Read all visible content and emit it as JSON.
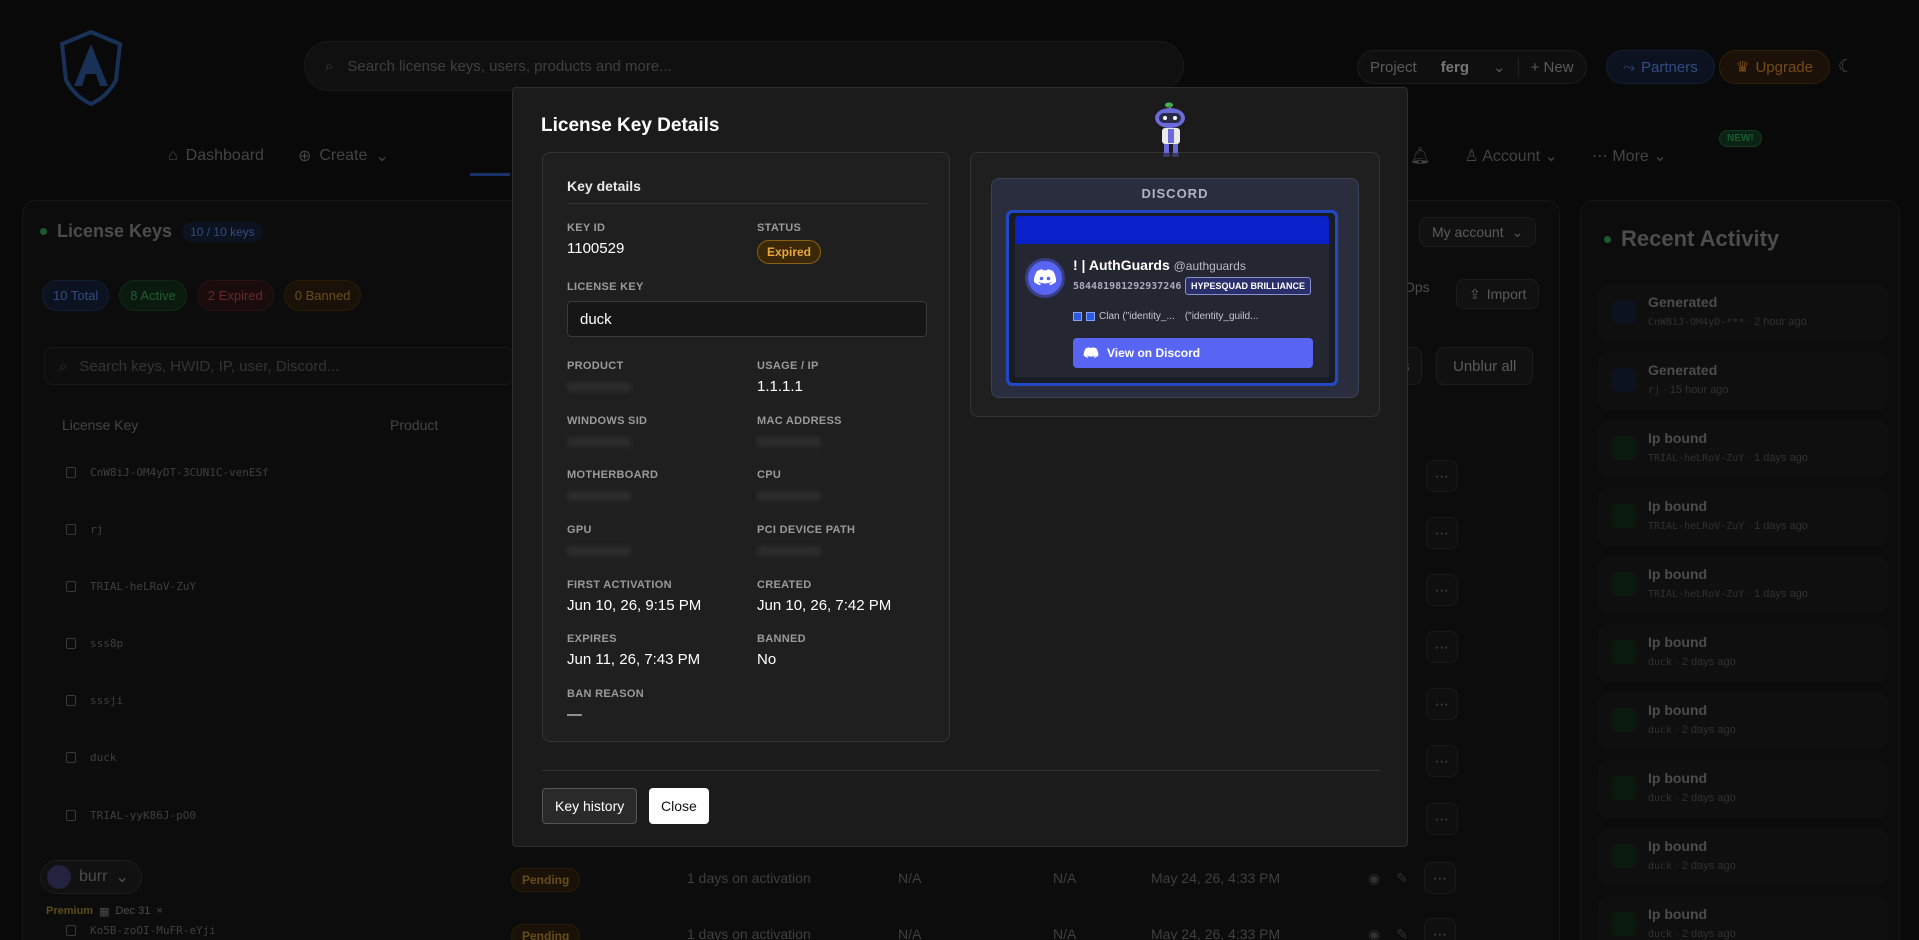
{
  "topbar": {
    "search_placeholder": "Search license keys, users, products and more...",
    "project_label": "Project",
    "project_name": "ferg",
    "new_label": "+ New",
    "partners_label": "Partners",
    "upgrade_label": "Upgrade"
  },
  "nav": {
    "items": [
      "Dashboard",
      "Create"
    ],
    "right_items": [
      "Account",
      "More"
    ],
    "new_badge": "NEW!"
  },
  "license_panel": {
    "title": "License Keys",
    "keys_pill": "10 / 10 keys",
    "pills": {
      "total": "10 Total",
      "active": "8 Active",
      "expired": "2 Expired",
      "banned": "0 Banned"
    },
    "search_placeholder": "Search keys, HWID, IP, user, Discord...",
    "unblur_label": "Unblur all",
    "my_account_label": "My account",
    "ops_label": "Ops",
    "import_label": "Import",
    "col_license_key": "License Key",
    "col_product": "Product",
    "rows": [
      "CnW8iJ-OM4yDT-3CUN1C-venESf",
      "rj",
      "TRIAL-heLRoV-ZuY",
      "sss8p",
      "sssji",
      "duck",
      "TRIAL-yyK86J-pO0",
      "",
      "Ko5B-zoOI-MuFR-eYji"
    ],
    "pending_label": "Pending",
    "activation_text": "1 days on activation",
    "na": "N/A",
    "created_text": "May 24, 26, 4:33 PM"
  },
  "user": {
    "name": "burr",
    "plan": "Premium",
    "date": "Dec 31"
  },
  "recent_activity": {
    "title": "Recent Activity",
    "items": [
      {
        "name": "Generated",
        "key": "CnW8iJ-OM4yD-***",
        "time": "2 hour ago",
        "kind": "generated"
      },
      {
        "name": "Generated",
        "key": "rj",
        "time": "15 hour ago",
        "kind": "generated"
      },
      {
        "name": "Ip bound",
        "key": "TRIAL-heLRoV-ZuY",
        "time": "1 days ago",
        "kind": "ip"
      },
      {
        "name": "Ip bound",
        "key": "TRIAL-heLRoV-ZuY",
        "time": "1 days ago",
        "kind": "ip"
      },
      {
        "name": "Ip bound",
        "key": "TRIAL-heLRoV-ZuY",
        "time": "1 days ago",
        "kind": "ip"
      },
      {
        "name": "Ip bound",
        "key": "duck",
        "time": "2 days ago",
        "kind": "ip"
      },
      {
        "name": "Ip bound",
        "key": "duck",
        "time": "2 days ago",
        "kind": "ip"
      },
      {
        "name": "Ip bound",
        "key": "duck",
        "time": "2 days ago",
        "kind": "ip"
      },
      {
        "name": "Ip bound",
        "key": "duck",
        "time": "2 days ago",
        "kind": "ip"
      },
      {
        "name": "Ip bound",
        "key": "duck",
        "time": "2 days ago",
        "kind": "ip"
      }
    ]
  },
  "modal": {
    "title": "License Key Details",
    "section_title": "Key details",
    "key_id_label": "KEY ID",
    "key_id": "1100529",
    "status_label": "STATUS",
    "status": "Expired",
    "license_key_label": "LICENSE KEY",
    "license_key": "duck",
    "product_label": "PRODUCT",
    "usage_label": "USAGE / IP",
    "usage": "1.1.1.1",
    "windows_sid_label": "WINDOWS SID",
    "mac_label": "MAC ADDRESS",
    "motherboard_label": "MOTHERBOARD",
    "cpu_label": "CPU",
    "gpu_label": "GPU",
    "pci_label": "PCI DEVICE PATH",
    "first_activation_label": "FIRST ACTIVATION",
    "first_activation": "Jun 10, 26, 9:15 PM",
    "created_label": "CREATED",
    "created": "Jun 10, 26, 7:42 PM",
    "expires_label": "EXPIRES",
    "expires": "Jun 11, 26, 7:43 PM",
    "banned_label": "BANNED",
    "banned": "No",
    "ban_reason_label": "BAN REASON",
    "ban_reason": "—",
    "key_history_label": "Key history",
    "close_label": "Close"
  },
  "discord": {
    "header": "DISCORD",
    "display_name": "! | AuthGuards",
    "username": "@authguards",
    "user_id": "584481981292937246",
    "badge": "HYPESQUAD BRILLIANCE",
    "clan_1": "Clan (\"identity_...",
    "clan_2": "(\"identity_guild...",
    "view_label": "View on Discord",
    "blurple": "#5865f2"
  }
}
